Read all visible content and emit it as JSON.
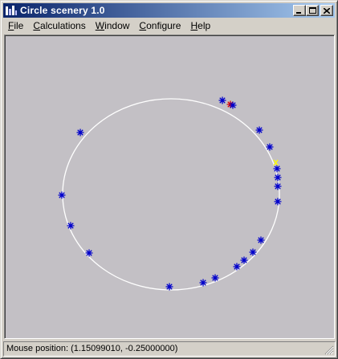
{
  "window": {
    "title": "Circle scenery 1.0"
  },
  "title_buttons": {
    "minimize": "_",
    "maximize": "□",
    "close": "×"
  },
  "menu": [
    {
      "label": "File",
      "mnemonic": "F",
      "rest": "ile"
    },
    {
      "label": "Calculations",
      "mnemonic": "C",
      "rest": "alculations"
    },
    {
      "label": "Window",
      "mnemonic": "W",
      "rest": "indow"
    },
    {
      "label": "Configure",
      "mnemonic": "C",
      "rest": "onfigure"
    },
    {
      "label": "Help",
      "mnemonic": "H",
      "rest": "elp"
    }
  ],
  "status": {
    "text": "Mouse position: (1.15099010, -0.25000000)"
  },
  "colors": {
    "canvas_bg": "#c3c0c5",
    "circle": "#ffffff",
    "point": "#0000cc",
    "highlight_point": "#e00000",
    "cursor_mark": "#ffff00"
  }
}
